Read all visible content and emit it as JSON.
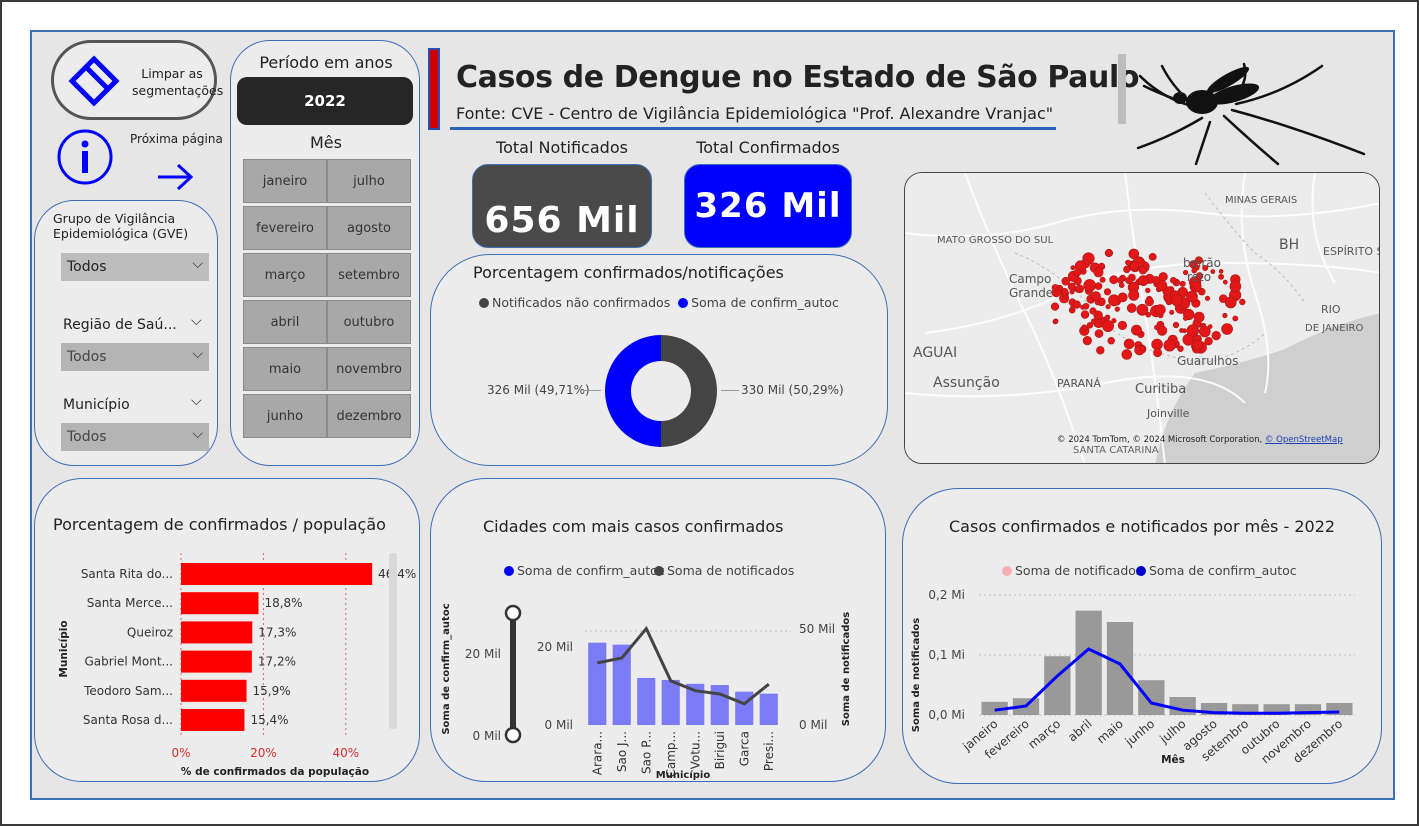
{
  "header": {
    "title": "Casos de Dengue no Estado de São Paulo",
    "source": "Fonte: CVE - Centro de Vigilância Epidemiológica \"Prof. Alexandre Vranjac\""
  },
  "controls": {
    "clear_label": "Limpar as segmentações",
    "next_page_label": "Próxima página",
    "gve_label": "Grupo de Vigilância Epidemiológica (GVE)",
    "gve_value": "Todos",
    "regiao_label": "Região de Saú...",
    "regiao_value": "Todos",
    "municipio_label": "Município",
    "municipio_value": "Todos"
  },
  "period": {
    "label": "Período em anos",
    "year": "2022",
    "month_label": "Mês",
    "months_left": [
      "janeiro",
      "fevereiro",
      "março",
      "abril",
      "maio",
      "junho"
    ],
    "months_right": [
      "julho",
      "agosto",
      "setembro",
      "outubro",
      "novembro",
      "dezembro"
    ]
  },
  "kpis": {
    "notificados_label": "Total Notificados",
    "notificados_value": "656 Mil",
    "confirmados_label": "Total Confirmados",
    "confirmados_value": "326 Mil"
  },
  "donut": {
    "title": "Porcentagem confirmados/notificações",
    "legend_a": "Notificados não confirmados",
    "legend_b": "Soma de confirm_autoc",
    "label_left": "326 Mil (49,71%)",
    "label_right": "330 Mil (50,29%)",
    "colors": {
      "a": "#444444",
      "b": "#0000ff"
    }
  },
  "map": {
    "labels": {
      "minas": "MINAS GERAIS",
      "mato": "MATO GROSSO DO SUL",
      "bh": "BH",
      "espirito": "ESPÍRITO S",
      "campo": "Campo",
      "grande": "Grande",
      "ribeirao": "beirão",
      "reto": "reto",
      "rio": "RIO",
      "dejaneiro": "DE JANEIRO",
      "aguai": "AGUAI",
      "assuncao": "Assunção",
      "parana": "PARANÁ",
      "curitiba": "Curitiba",
      "guarulhos": "Guarulhos",
      "joinville": "Joinville",
      "santa": "SANTA CATARINA"
    },
    "attribution": "© 2024 TomTom, © 2024 Microsoft Corporation,",
    "attribution_link": "© OpenStreetMap"
  },
  "chart_data": [
    {
      "type": "bar",
      "title": "Porcentagem de confirmados / população",
      "orientation": "horizontal",
      "categories": [
        "Santa Rita do...",
        "Santa Merce...",
        "Queiroz",
        "Gabriel Mont...",
        "Teodoro Sam...",
        "Santa Rosa d..."
      ],
      "values": [
        46.4,
        18.8,
        17.3,
        17.2,
        15.9,
        15.4
      ],
      "value_labels": [
        "46,4%",
        "18,8%",
        "17,3%",
        "17,2%",
        "15,9%",
        "15,4%"
      ],
      "xlabel": "% de confirmados da população",
      "ylabel": "Município",
      "xticks": [
        "0%",
        "20%",
        "40%"
      ],
      "xlim": [
        0,
        50
      ],
      "color": "#ff0000"
    },
    {
      "type": "bar",
      "title": "Cidades com mais casos confirmados",
      "categories": [
        "Arara...",
        "Sao J...",
        "Sao P...",
        "Camp...",
        "Votu...",
        "Birigui",
        "Garca",
        "Presi..."
      ],
      "series": [
        {
          "name": "Soma de confirm_autoc",
          "values": [
            21000,
            20500,
            12000,
            11500,
            10500,
            10200,
            8500,
            8000
          ],
          "color": "#7b7bf5"
        },
        {
          "name": "Soma de notificados",
          "values": [
            38000,
            41000,
            59000,
            27000,
            21000,
            19000,
            13000,
            25000
          ],
          "color": "#444444"
        }
      ],
      "xlabel": "Município",
      "ylabel_left": "Soma de confirm_autoc",
      "ylabel_right": "Soma de notificados",
      "yticks_left": [
        "20 Mil",
        "0 Mil"
      ],
      "yticks_right": [
        "50 Mil",
        "0 Mil"
      ],
      "ylim_left": [
        0,
        25000
      ],
      "ylim_right": [
        0,
        60000
      ],
      "slider_ticks": [
        "20 Mil",
        "0 Mil"
      ]
    },
    {
      "type": "bar",
      "title": "Casos confirmados e notificados por mês - 2022",
      "categories": [
        "janeiro",
        "fevereiro",
        "março",
        "abril",
        "maio",
        "junho",
        "julho",
        "agosto",
        "setembro",
        "outubro",
        "novembro",
        "dezembro"
      ],
      "series": [
        {
          "name": "Soma de notificados",
          "values": [
            0.022,
            0.028,
            0.098,
            0.174,
            0.155,
            0.058,
            0.03,
            0.02,
            0.018,
            0.018,
            0.018,
            0.02
          ],
          "color": "#999999"
        },
        {
          "name": "Soma de confirm_autoc",
          "values": [
            0.008,
            0.015,
            0.065,
            0.11,
            0.085,
            0.02,
            0.008,
            0.004,
            0.003,
            0.003,
            0.004,
            0.005
          ],
          "color": "#0000ff"
        }
      ],
      "legend_colors": [
        "#f4b0b5",
        "#0000cc"
      ],
      "xlabel": "Mês",
      "ylabel": "Soma de notificados",
      "yticks": [
        "0,2 Mi",
        "0,1 Mi",
        "0,0 Mi"
      ],
      "ylim": [
        0,
        0.2
      ]
    }
  ]
}
